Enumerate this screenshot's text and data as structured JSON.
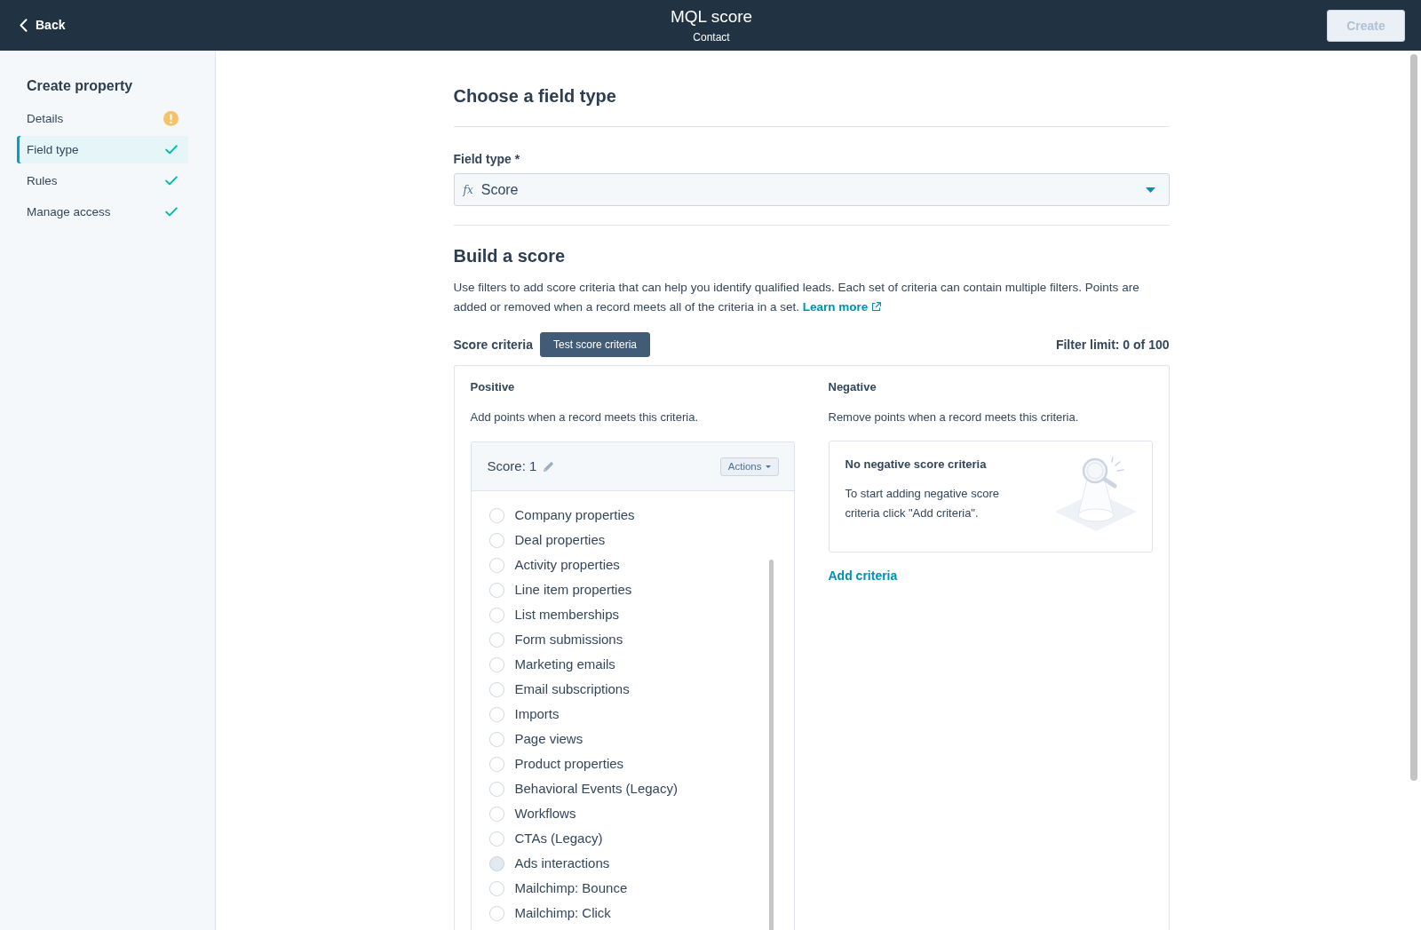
{
  "top_bar": {
    "back": "Back",
    "title": "MQL score",
    "subtitle": "Contact",
    "create_button": {
      "label": "Create",
      "disabled": true
    }
  },
  "sidebar": {
    "title": "Create property",
    "steps": [
      {
        "label": "Details",
        "complete": false,
        "selected": false
      },
      {
        "label": "Field type",
        "complete": true,
        "selected": true
      },
      {
        "label": "Rules",
        "complete": true,
        "selected": false
      },
      {
        "label": "Manage access",
        "complete": true,
        "selected": false
      }
    ]
  },
  "field_type": {
    "heading": "Choose a field type",
    "label": "Field type *",
    "icon": "fx",
    "value": "Score"
  },
  "build_score": {
    "heading": "Build a score",
    "description": "Use filters to add score criteria that can help you identify qualified leads. Each set of criteria can contain multiple filters. Points are added or removed when a record meets all of the criteria in a set.",
    "learn_more": "Learn more",
    "criteria_label": "Score criteria",
    "test_button": "Test score criteria",
    "filter_limit": "Filter limit: 0 of 100"
  },
  "positive": {
    "title": "Positive",
    "description": "Add points when a record meets this criteria.",
    "score": "Score: 1",
    "actions": "Actions",
    "options": [
      {
        "label": "Company properties",
        "selected": false,
        "hovered": false
      },
      {
        "label": "Deal properties",
        "selected": false,
        "hovered": false
      },
      {
        "label": "Activity properties",
        "selected": false,
        "hovered": false
      },
      {
        "label": "Line item properties",
        "selected": false,
        "hovered": false
      },
      {
        "label": "List memberships",
        "selected": false,
        "hovered": false
      },
      {
        "label": "Form submissions",
        "selected": false,
        "hovered": false
      },
      {
        "label": "Marketing emails",
        "selected": false,
        "hovered": false
      },
      {
        "label": "Email subscriptions",
        "selected": false,
        "hovered": false
      },
      {
        "label": "Imports",
        "selected": false,
        "hovered": false
      },
      {
        "label": "Page views",
        "selected": false,
        "hovered": false
      },
      {
        "label": "Product properties",
        "selected": false,
        "hovered": false
      },
      {
        "label": "Behavioral Events (Legacy)",
        "selected": false,
        "hovered": false
      },
      {
        "label": "Workflows",
        "selected": false,
        "hovered": false
      },
      {
        "label": "CTAs (Legacy)",
        "selected": false,
        "hovered": false
      },
      {
        "label": "Ads interactions",
        "selected": false,
        "hovered": true
      },
      {
        "label": "Mailchimp: Bounce",
        "selected": false,
        "hovered": false
      },
      {
        "label": "Mailchimp: Click",
        "selected": false,
        "hovered": false
      }
    ]
  },
  "negative": {
    "title": "Negative",
    "description": "Remove points when a record meets this criteria.",
    "empty_title": "No negative score criteria",
    "empty_text": "To start adding negative score criteria click \"Add criteria\".",
    "add_criteria": "Add criteria"
  }
}
